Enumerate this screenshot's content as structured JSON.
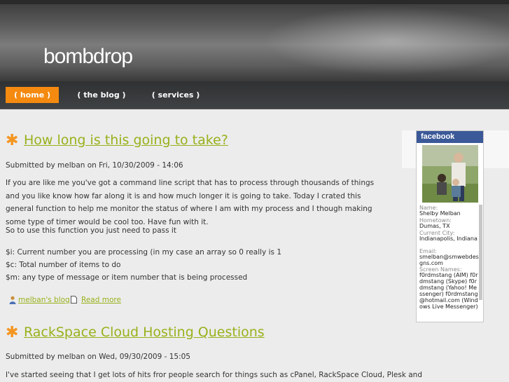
{
  "site": {
    "name": "bombdrop"
  },
  "nav": {
    "items": [
      {
        "label": "( home )",
        "active": true
      },
      {
        "label": "( the blog )",
        "active": false
      },
      {
        "label": "( services )",
        "active": false
      }
    ]
  },
  "posts": [
    {
      "title": "How long is this going to take?",
      "submitted": "Submitted by melban on Fri, 10/30/2009 - 14:06",
      "body": "If you are like me you've got a command line script that has to process through thousands of things and you like know how far along it is and how much longer it is going to take. Today I crated this general function to help me monitor the status of where I am with my process and I though making some type of timer would be cool too. Have fun with it.",
      "intro": "So to use this function you just need to pass it",
      "params": [
        "$i: Current number you are processing (in my case an array so 0 really is 1",
        "$c: Total number of items to do",
        "$m: any type of message or item number that is being processed"
      ],
      "blog_link": "melban's blog",
      "read_more": "Read more"
    },
    {
      "title": "RackSpace Cloud Hosting Questions",
      "submitted": "Submitted by melban on Wed, 09/30/2009 - 15:05",
      "body": "I've started seeing that I get lots of hits fror people search for things such as cPanel, RackSpace Cloud, Plesk and"
    }
  ],
  "facebook": {
    "brand": "facebook",
    "fields": [
      {
        "label": "Name:",
        "value": "Shelby Melban"
      },
      {
        "label": "Hometown:",
        "value": "Dumas, TX"
      },
      {
        "label": "Current City:",
        "value": "Indianapolis, Indiana"
      },
      {
        "label": "Email:",
        "value": "smelban@smwebdesigns.com"
      },
      {
        "label": "Screen Names:",
        "value": "f0rdmstang (AIM) f0rdmstang (Skype) f0rdmstang (Yahoo! Messenger) f0rdmstang@hotmail.com (Windows Live Messenger)"
      }
    ]
  },
  "colors": {
    "accent_orange": "#f48a10",
    "title_green": "#99b11b",
    "facebook_blue": "#3b5998"
  }
}
